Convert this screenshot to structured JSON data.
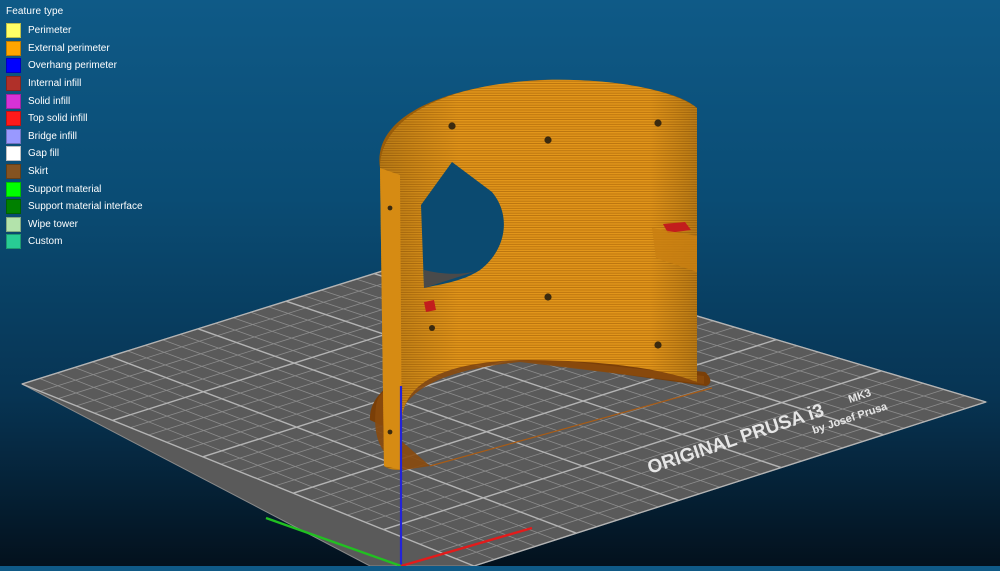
{
  "legend": {
    "title": "Feature type",
    "items": [
      {
        "label": "Perimeter",
        "color": "#ffff66",
        "icon": "perimeter-swatch-icon"
      },
      {
        "label": "External perimeter",
        "color": "#ffa500",
        "icon": "external-perimeter-swatch-icon"
      },
      {
        "label": "Overhang perimeter",
        "color": "#0000ff",
        "icon": "overhang-perimeter-swatch-icon"
      },
      {
        "label": "Internal infill",
        "color": "#b03029",
        "icon": "internal-infill-swatch-icon"
      },
      {
        "label": "Solid infill",
        "color": "#d732d7",
        "icon": "solid-infill-swatch-icon"
      },
      {
        "label": "Top solid infill",
        "color": "#ff1a1a",
        "icon": "top-solid-infill-swatch-icon"
      },
      {
        "label": "Bridge infill",
        "color": "#9999ff",
        "icon": "bridge-infill-swatch-icon"
      },
      {
        "label": "Gap fill",
        "color": "#ffffff",
        "icon": "gap-fill-swatch-icon"
      },
      {
        "label": "Skirt",
        "color": "#845321",
        "icon": "skirt-swatch-icon"
      },
      {
        "label": "Support material",
        "color": "#00ff00",
        "icon": "support-material-swatch-icon"
      },
      {
        "label": "Support material interface",
        "color": "#008000",
        "icon": "support-interface-swatch-icon"
      },
      {
        "label": "Wipe tower",
        "color": "#b3e3ab",
        "icon": "wipe-tower-swatch-icon"
      },
      {
        "label": "Custom",
        "color": "#28cc94",
        "icon": "custom-swatch-icon"
      }
    ]
  },
  "bed": {
    "brand_line1": "ORIGINAL PRUSA i3",
    "brand_model": "MK3",
    "brand_line2": "by Josef Prusa"
  },
  "model": {
    "color": "#e69a1b",
    "description_icon": "printed-part-preview"
  },
  "axes": {
    "x_color": "#e31b1b",
    "y_color": "#21c021",
    "z_color": "#2323d8"
  }
}
